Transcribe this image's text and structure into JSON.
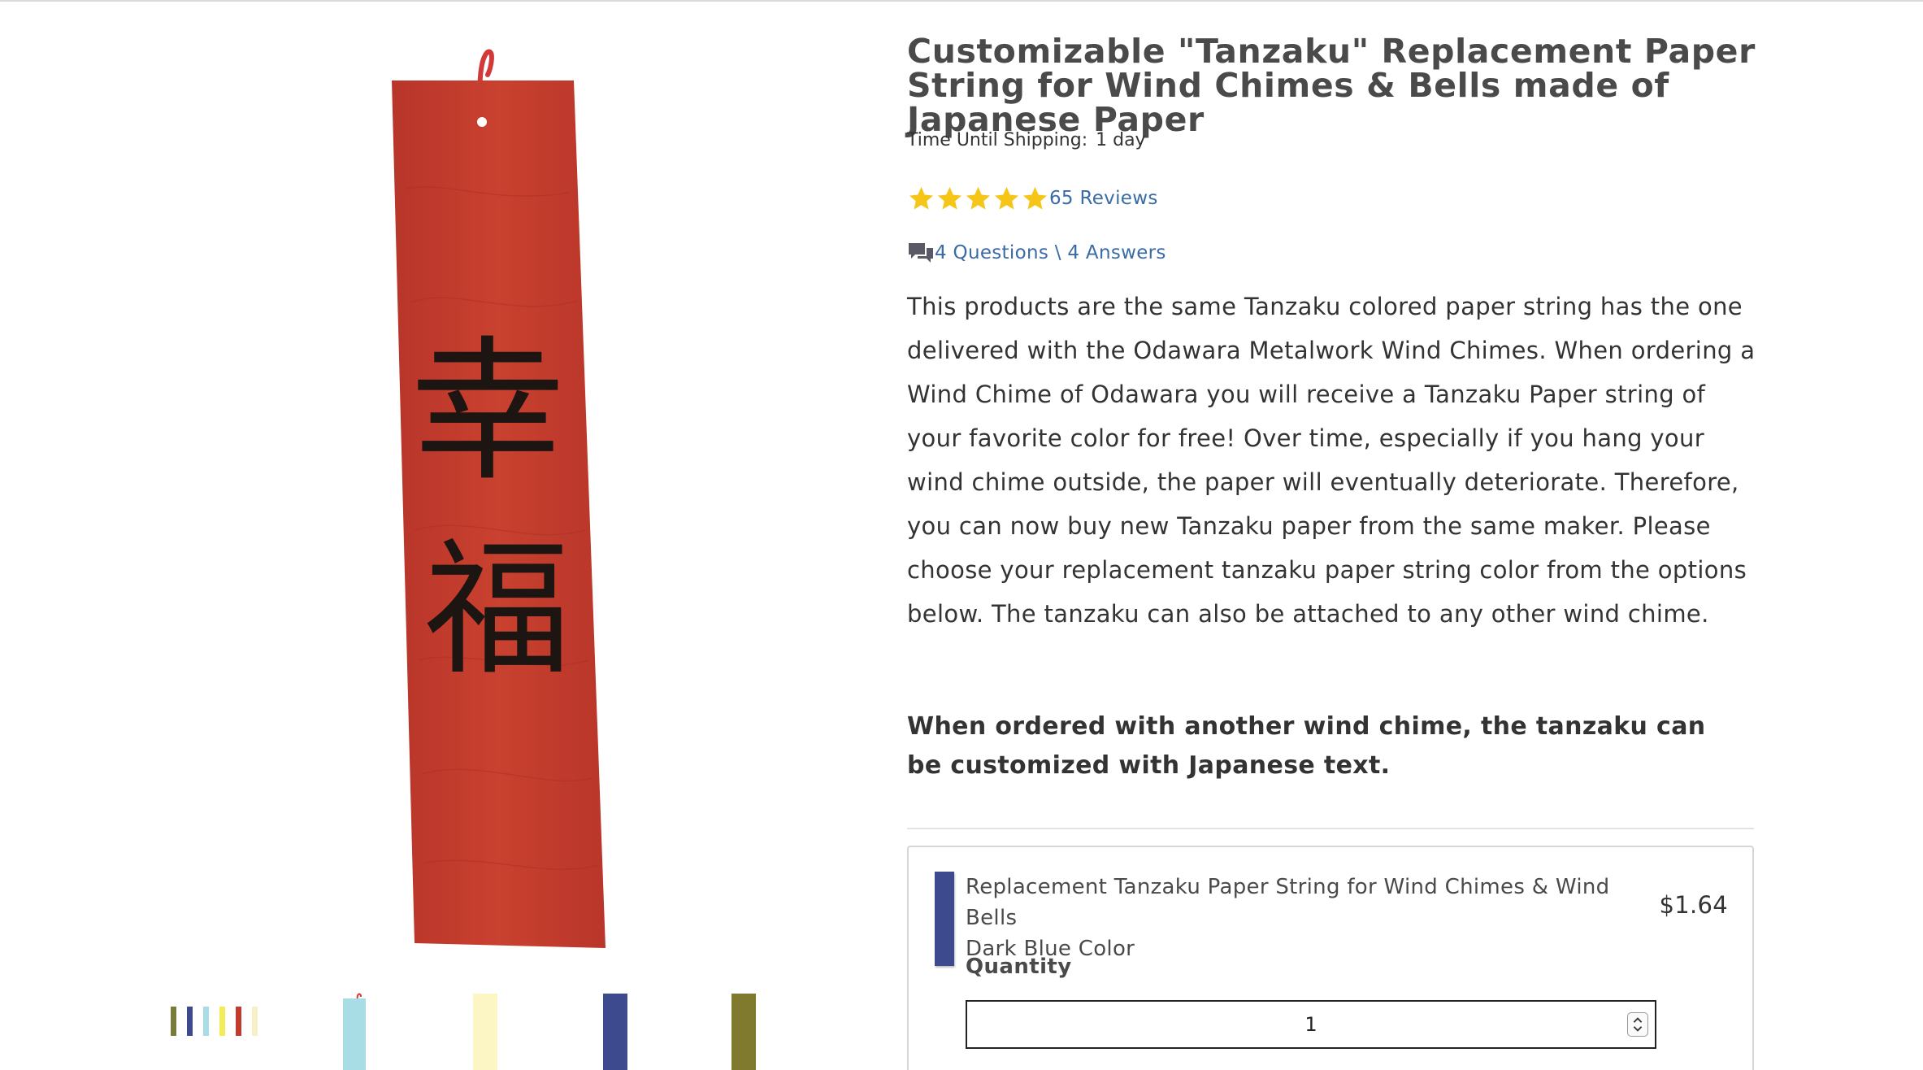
{
  "product": {
    "title": "Customizable \"Tanzaku\" Replacement Paper String for Wind Chimes & Bells made of Japanese Paper",
    "shipping_label": "Time Until Shipping:",
    "shipping_value": "1 day",
    "rating": 5,
    "reviews_link": "65 Reviews",
    "qa_link": "4 Questions \\ 4 Answers",
    "description": "This products are the same Tanzaku colored paper string has the one delivered with the Odawara Metalwork Wind Chimes. When ordering a Wind Chime of Odawara you will receive a Tanzaku Paper string of your favorite color for free! Over time, especially if you hang your wind chime outside, the paper will eventually deteriorate. Therefore, you can now buy new Tanzaku paper from the same maker. Please choose your replacement tanzaku paper string color from the options below. The tanzaku can also be attached to any other wind chime.",
    "note": "When ordered with another wind chime, the tanzaku can be customized with Japanese text."
  },
  "gallery": {
    "main_image": {
      "paper_color": "#c23b2f",
      "calligraphy": "幸福"
    },
    "thumbnails": [
      {
        "name": "thumb-all-colors",
        "colors": [
          "#7a7a3a",
          "#3e4a8e",
          "#a8dde6",
          "#f2ec5a",
          "#c23b2f",
          "#f7f0c6"
        ]
      },
      {
        "name": "thumb-light-blue",
        "color": "#a8dde6"
      },
      {
        "name": "thumb-cream",
        "color": "#fbf6c4"
      },
      {
        "name": "thumb-dark-blue",
        "color": "#3e4a8e"
      },
      {
        "name": "thumb-olive",
        "color": "#7f7a2e"
      }
    ]
  },
  "variant": {
    "swatch_color": "#3e4a8e",
    "name_line1": "Replacement Tanzaku Paper String for Wind Chimes & Wind Bells",
    "name_line2": "Dark Blue Color",
    "price": "$1.64",
    "quantity_label": "Quantity",
    "quantity_value": "1"
  },
  "colors": {
    "link": "#3a6ba5",
    "star": "#f5c518",
    "title": "#4a4a4a"
  }
}
